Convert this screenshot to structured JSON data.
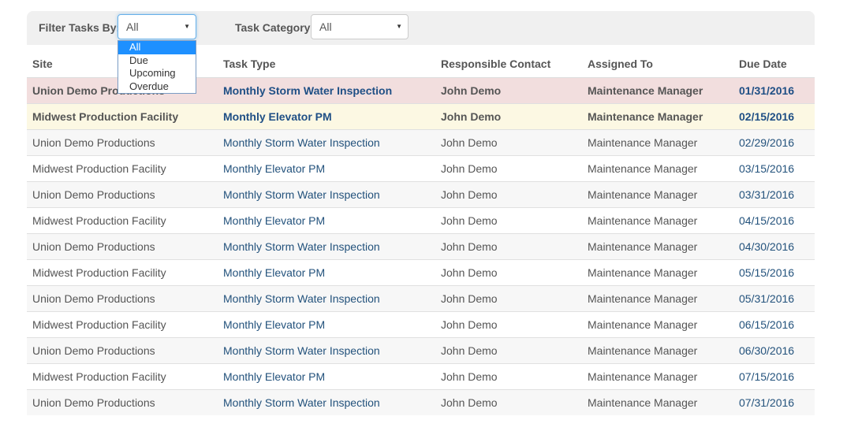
{
  "filter": {
    "tasks_label": "Filter Tasks By:",
    "tasks_value": "All",
    "tasks_options": [
      "All",
      "Due",
      "Upcoming",
      "Overdue"
    ],
    "category_label": "Task Category:",
    "category_value": "All"
  },
  "table": {
    "headers": [
      "Site",
      "Task Type",
      "Responsible Contact",
      "Assigned To",
      "Due Date"
    ],
    "rows": [
      {
        "status": "overdue",
        "site": "Union Demo Productions",
        "task": "Monthly Storm Water Inspection",
        "contact": "John Demo",
        "assigned": "Maintenance Manager",
        "due": "01/31/2016"
      },
      {
        "status": "due",
        "site": "Midwest Production Facility",
        "task": "Monthly Elevator PM",
        "contact": "John Demo",
        "assigned": "Maintenance Manager",
        "due": "02/15/2016"
      },
      {
        "status": "upcoming",
        "site": "Union Demo Productions",
        "task": "Monthly Storm Water Inspection",
        "contact": "John Demo",
        "assigned": "Maintenance Manager",
        "due": "02/29/2016"
      },
      {
        "status": "upcoming",
        "site": "Midwest Production Facility",
        "task": "Monthly Elevator PM",
        "contact": "John Demo",
        "assigned": "Maintenance Manager",
        "due": "03/15/2016"
      },
      {
        "status": "upcoming",
        "site": "Union Demo Productions",
        "task": "Monthly Storm Water Inspection",
        "contact": "John Demo",
        "assigned": "Maintenance Manager",
        "due": "03/31/2016"
      },
      {
        "status": "upcoming",
        "site": "Midwest Production Facility",
        "task": "Monthly Elevator PM",
        "contact": "John Demo",
        "assigned": "Maintenance Manager",
        "due": "04/15/2016"
      },
      {
        "status": "upcoming",
        "site": "Union Demo Productions",
        "task": "Monthly Storm Water Inspection",
        "contact": "John Demo",
        "assigned": "Maintenance Manager",
        "due": "04/30/2016"
      },
      {
        "status": "upcoming",
        "site": "Midwest Production Facility",
        "task": "Monthly Elevator PM",
        "contact": "John Demo",
        "assigned": "Maintenance Manager",
        "due": "05/15/2016"
      },
      {
        "status": "upcoming",
        "site": "Union Demo Productions",
        "task": "Monthly Storm Water Inspection",
        "contact": "John Demo",
        "assigned": "Maintenance Manager",
        "due": "05/31/2016"
      },
      {
        "status": "upcoming",
        "site": "Midwest Production Facility",
        "task": "Monthly Elevator PM",
        "contact": "John Demo",
        "assigned": "Maintenance Manager",
        "due": "06/15/2016"
      },
      {
        "status": "upcoming",
        "site": "Union Demo Productions",
        "task": "Monthly Storm Water Inspection",
        "contact": "John Demo",
        "assigned": "Maintenance Manager",
        "due": "06/30/2016"
      },
      {
        "status": "upcoming",
        "site": "Midwest Production Facility",
        "task": "Monthly Elevator PM",
        "contact": "John Demo",
        "assigned": "Maintenance Manager",
        "due": "07/15/2016"
      },
      {
        "status": "upcoming",
        "site": "Union Demo Productions",
        "task": "Monthly Storm Water Inspection",
        "contact": "John Demo",
        "assigned": "Maintenance Manager",
        "due": "07/31/2016"
      }
    ]
  }
}
